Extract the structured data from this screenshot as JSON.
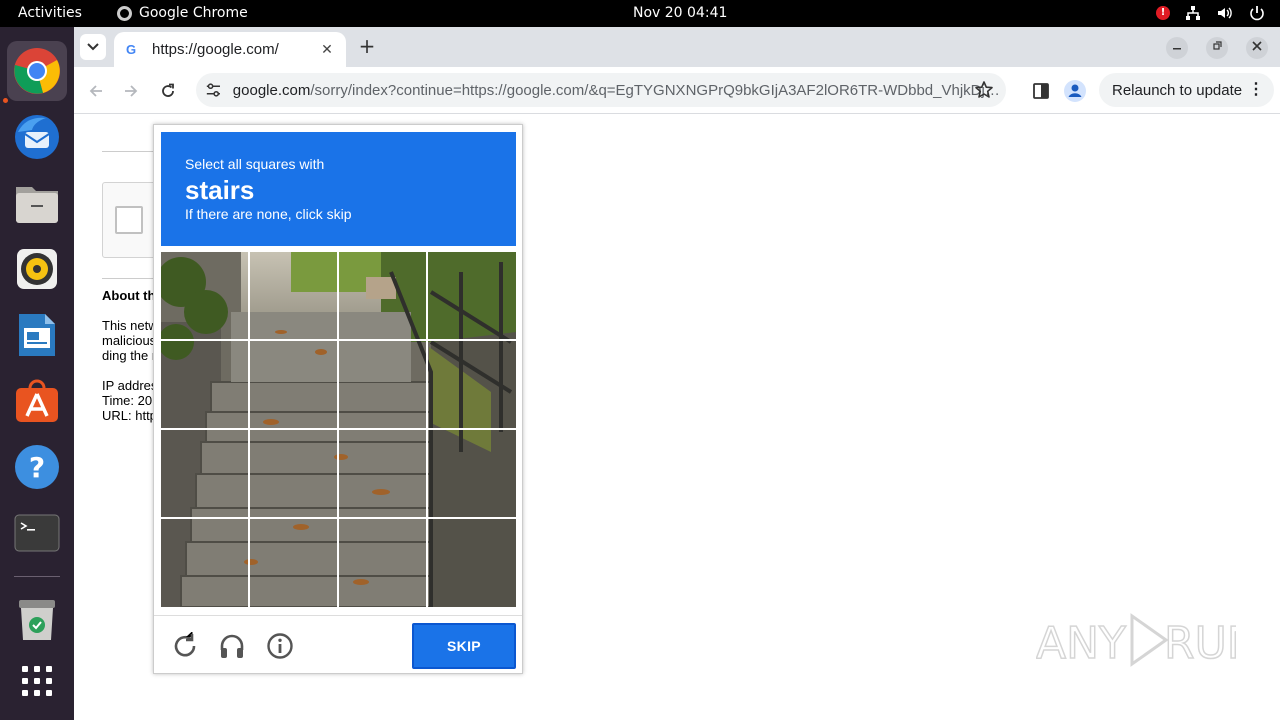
{
  "topbar": {
    "activities": "Activities",
    "app_name": "Google Chrome",
    "clock": "Nov 20  04:41",
    "alert_glyph": "!"
  },
  "dock": {
    "items": [
      "chrome-icon",
      "thunderbird-icon",
      "files-icon",
      "rhythmbox-icon",
      "libreoffice-impress-icon",
      "app-center-icon",
      "help-icon",
      "terminal-icon",
      "trash-icon",
      "show-apps-icon"
    ]
  },
  "browser": {
    "tab_title": "https://google.com/",
    "url_host": "google.com",
    "url_rest": "/sorry/index?continue=https://google.com/&q=EgTYGNXNGPrQ9bkGIjA3AF2lOR6TR-WDbbd_VhjkDjwO…",
    "relaunch_label": "Relaunch to update",
    "new_tab_glyph": "+",
    "close_tab_glyph": "✕",
    "more_glyph": "⋮"
  },
  "page": {
    "about_label": "About th",
    "para1": [
      "This netw",
      "malicious",
      "ding the r"
    ],
    "para2": [
      "IP addres",
      "Time: 20",
      "URL: http"
    ]
  },
  "captcha": {
    "instruction_line1": "Select all squares with",
    "target": "stairs",
    "instruction_line3": "If there are none, click skip",
    "skip_label": "SKIP",
    "grid_rows": 4,
    "grid_cols": 4
  },
  "watermark": {
    "text": "ANY RUN"
  },
  "colors": {
    "captcha_blue": "#1a73e8",
    "dock_bg": "#2a2231",
    "tabstrip_bg": "#dee1e6",
    "ubuntu_orange": "#e95420"
  }
}
